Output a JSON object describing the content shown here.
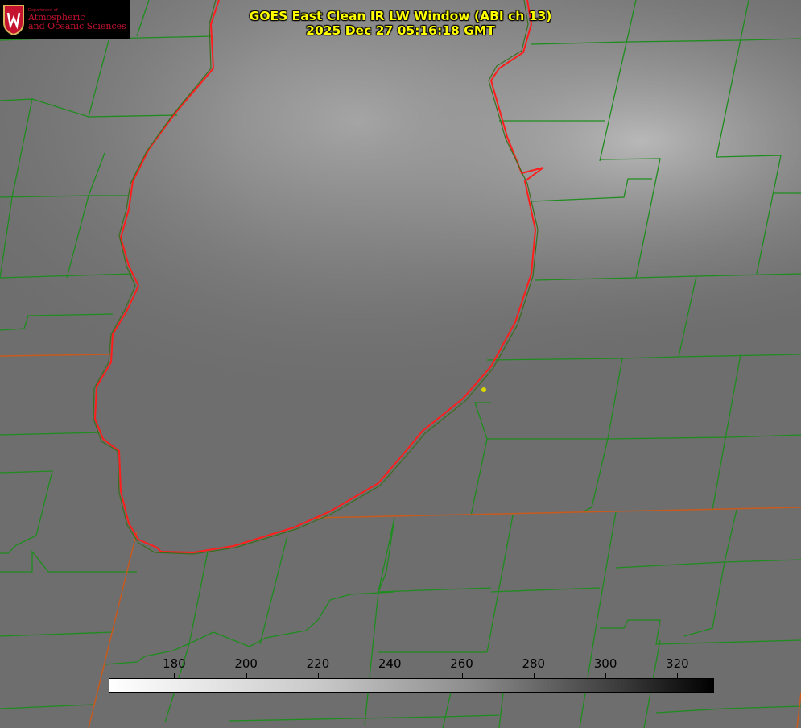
{
  "title": {
    "line1": "GOES East Clean IR LW Window (ABI ch 13)",
    "line2": "2025 Dec 27 05:16:18 GMT"
  },
  "logo": {
    "small": "Department of",
    "line1": "Atmospheric",
    "line2": "and Oceanic Sciences",
    "crest_letter": "W"
  },
  "colorbar": {
    "min": 162,
    "max": 330,
    "ticks": [
      "180",
      "200",
      "220",
      "240",
      "260",
      "280",
      "300",
      "320"
    ],
    "tick_values": [
      180,
      200,
      220,
      240,
      260,
      280,
      300,
      320
    ]
  },
  "colors": {
    "title": "#ffff00",
    "county_lines": "#1e8c1e",
    "state_lines": "#c85a1e",
    "coastline": "#ff1e1e",
    "marker": "#d8d800"
  }
}
